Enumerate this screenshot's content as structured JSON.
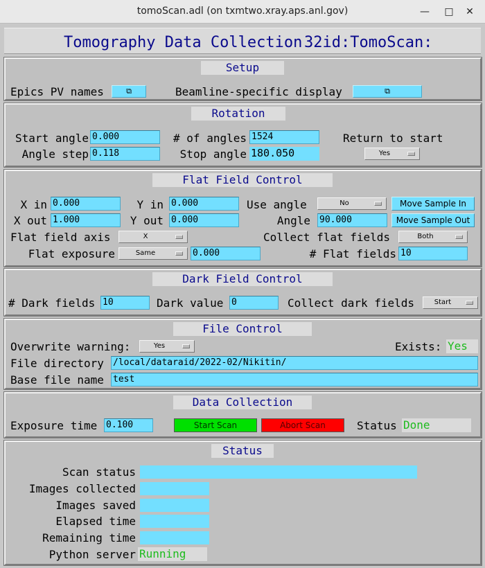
{
  "window": {
    "title": "tomoScan.adl (on txmtwo.xray.aps.anl.gov)",
    "min_icon": "minimize-icon",
    "max_icon": "maximize-icon",
    "close_icon": "close-icon"
  },
  "header": {
    "title": "Tomography Data Collection",
    "prefix": "32id:TomoScan:"
  },
  "setup": {
    "title": "Setup",
    "epics_label": "Epics PV names",
    "beamline_label": "Beamline-specific display",
    "related_icon": "related-display-icon"
  },
  "rotation": {
    "title": "Rotation",
    "start_angle_label": "Start angle",
    "start_angle": "0.000",
    "num_angles_label": "# of angles",
    "num_angles": "1524",
    "return_label": "Return to start",
    "angle_step_label": "Angle step",
    "angle_step": "0.118",
    "stop_angle_label": "Stop angle",
    "stop_angle": "180.050",
    "return_value": "Yes"
  },
  "flat": {
    "title": "Flat Field Control",
    "x_in_label": "X in",
    "x_in": "0.000",
    "y_in_label": "Y in",
    "y_in": "0.000",
    "use_angle_label": "Use angle",
    "use_angle": "No",
    "move_in": "Move Sample In",
    "x_out_label": "X out",
    "x_out": "1.000",
    "y_out_label": "Y out",
    "y_out": "0.000",
    "angle_label": "Angle",
    "angle": "90.000",
    "move_out": "Move Sample Out",
    "axis_label": "Flat field axis",
    "axis": "X",
    "collect_label": "Collect flat fields",
    "collect": "Both",
    "exposure_label": "Flat exposure",
    "exposure_mode": "Same",
    "exposure": "0.000",
    "num_label": "# Flat fields",
    "num": "10"
  },
  "dark": {
    "title": "Dark Field Control",
    "num_label": "# Dark fields",
    "num": "10",
    "value_label": "Dark value",
    "value": "0",
    "collect_label": "Collect dark fields",
    "collect": "Start"
  },
  "file": {
    "title": "File Control",
    "overwrite_label": "Overwrite warning:",
    "overwrite": "Yes",
    "exists_label": "Exists:",
    "exists": "Yes",
    "dir_label": "File directory",
    "dir": "/local/dataraid/2022-02/Nikitin/",
    "base_label": "Base file name",
    "base": "test"
  },
  "collection": {
    "title": "Data Collection",
    "exposure_label": "Exposure time",
    "exposure": "0.100",
    "start": "Start Scan",
    "abort": "Abort Scan",
    "status_label": "Status",
    "status": "Done",
    "start_color": "#00e000",
    "abort_color": "#ff0000"
  },
  "status": {
    "title": "Status",
    "scan_status_label": "Scan status",
    "images_collected_label": "Images collected",
    "images_saved_label": "Images saved",
    "elapsed_label": "Elapsed time",
    "remaining_label": "Remaining time",
    "python_label": "Python server",
    "python": "Running"
  }
}
